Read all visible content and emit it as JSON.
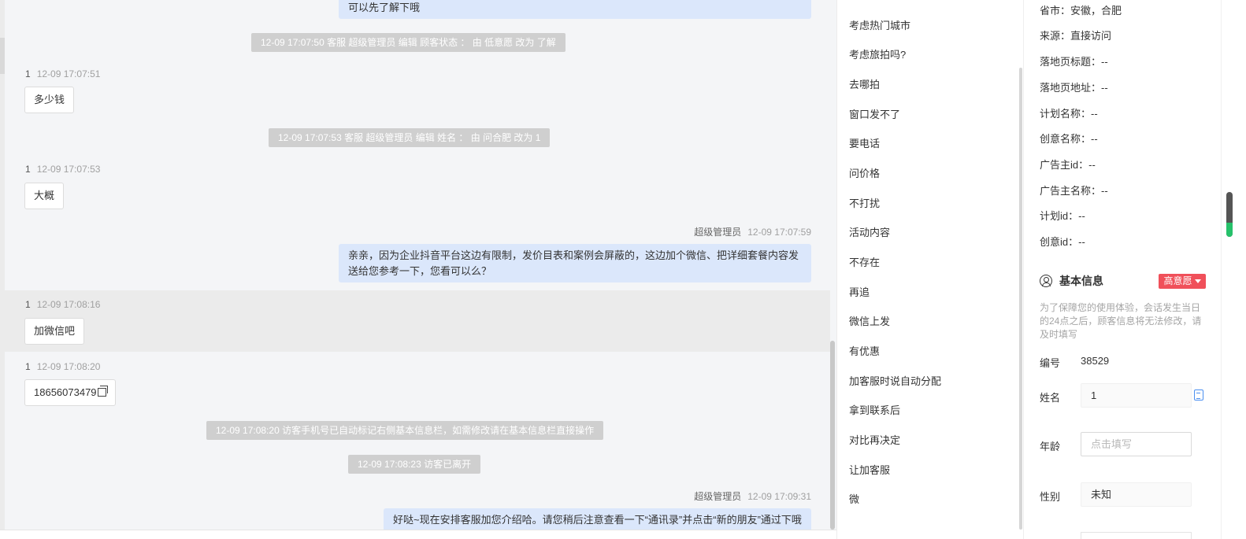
{
  "chat": {
    "partial_top_message": "可以先了解下哦",
    "messages": [
      {
        "kind": "system",
        "text": "12-09 17:07:50 客服 超级管理员 编辑 顾客状态 ： 由 低意愿 改为 了解"
      },
      {
        "kind": "visitor",
        "name": "1",
        "time": "12-09 17:07:51",
        "text": "多少钱"
      },
      {
        "kind": "system",
        "text": "12-09 17:07:53 客服 超级管理员 编辑 姓名 ： 由 问合肥 改为 1"
      },
      {
        "kind": "visitor",
        "name": "1",
        "time": "12-09 17:07:53",
        "text": "大概"
      },
      {
        "kind": "agent",
        "name": "超级管理员",
        "time": "12-09 17:07:59",
        "text": "亲亲，因为企业抖音平台这边有限制，发价目表和案例会屏蔽的，这边加个微信、把详细套餐内容发送给您参考一下，您看可以么？"
      },
      {
        "kind": "visitor",
        "name": "1",
        "time": "12-09 17:08:16",
        "text": "加微信吧"
      },
      {
        "kind": "visitor",
        "name": "1",
        "time": "12-09 17:08:20",
        "text": "18656073479"
      },
      {
        "kind": "system",
        "text": "12-09 17:08:20 访客手机号已自动标记右侧基本信息栏，如需修改请在基本信息栏直接操作"
      },
      {
        "kind": "system",
        "text": "12-09 17:08:23 访客已离开"
      },
      {
        "kind": "agent",
        "name": "超级管理员",
        "time": "12-09 17:09:31",
        "text": "好哒~现在安排客服加您介绍哈。请您稍后注意查看一下“通讯录”并点击“新的朋友”通过下哦"
      }
    ]
  },
  "quick_replies": [
    "考虑热门城市",
    "考虑旅拍吗?",
    "去哪拍",
    "窗口发不了",
    "要电话",
    "问价格",
    "不打扰",
    "活动内容",
    "不存在",
    "再追",
    "微信上发",
    "有优惠",
    "加客服时说自动分配",
    "拿到联系后",
    "对比再决定",
    "让加客服",
    "微"
  ],
  "info": {
    "source_rows": [
      "省市：安徽，合肥",
      "来源：直接访问",
      "落地页标题：--",
      "落地页地址：--",
      "计划名称：--",
      "创意名称：--",
      "广告主id：--",
      "广告主名称：--",
      "计划id：--",
      "创意id：--"
    ],
    "section_title": "基本信息",
    "intent_badge": "高意愿",
    "notice": "为了保障您的使用体验，会话发生当日的24点之后，顾客信息将无法修改，请及时填写",
    "id_label": "编号",
    "id_value": "38529",
    "name_label": "姓名",
    "name_value": "1",
    "age_label": "年龄",
    "age_placeholder": "点击填写",
    "gender_label": "性别",
    "gender_value": "未知"
  },
  "colors": {
    "agent_bubble": "#dbe7fb",
    "system_pill": "#cfcfcf",
    "intent_badge": "#f0505a",
    "copy_icon": "#4a8ff0"
  }
}
